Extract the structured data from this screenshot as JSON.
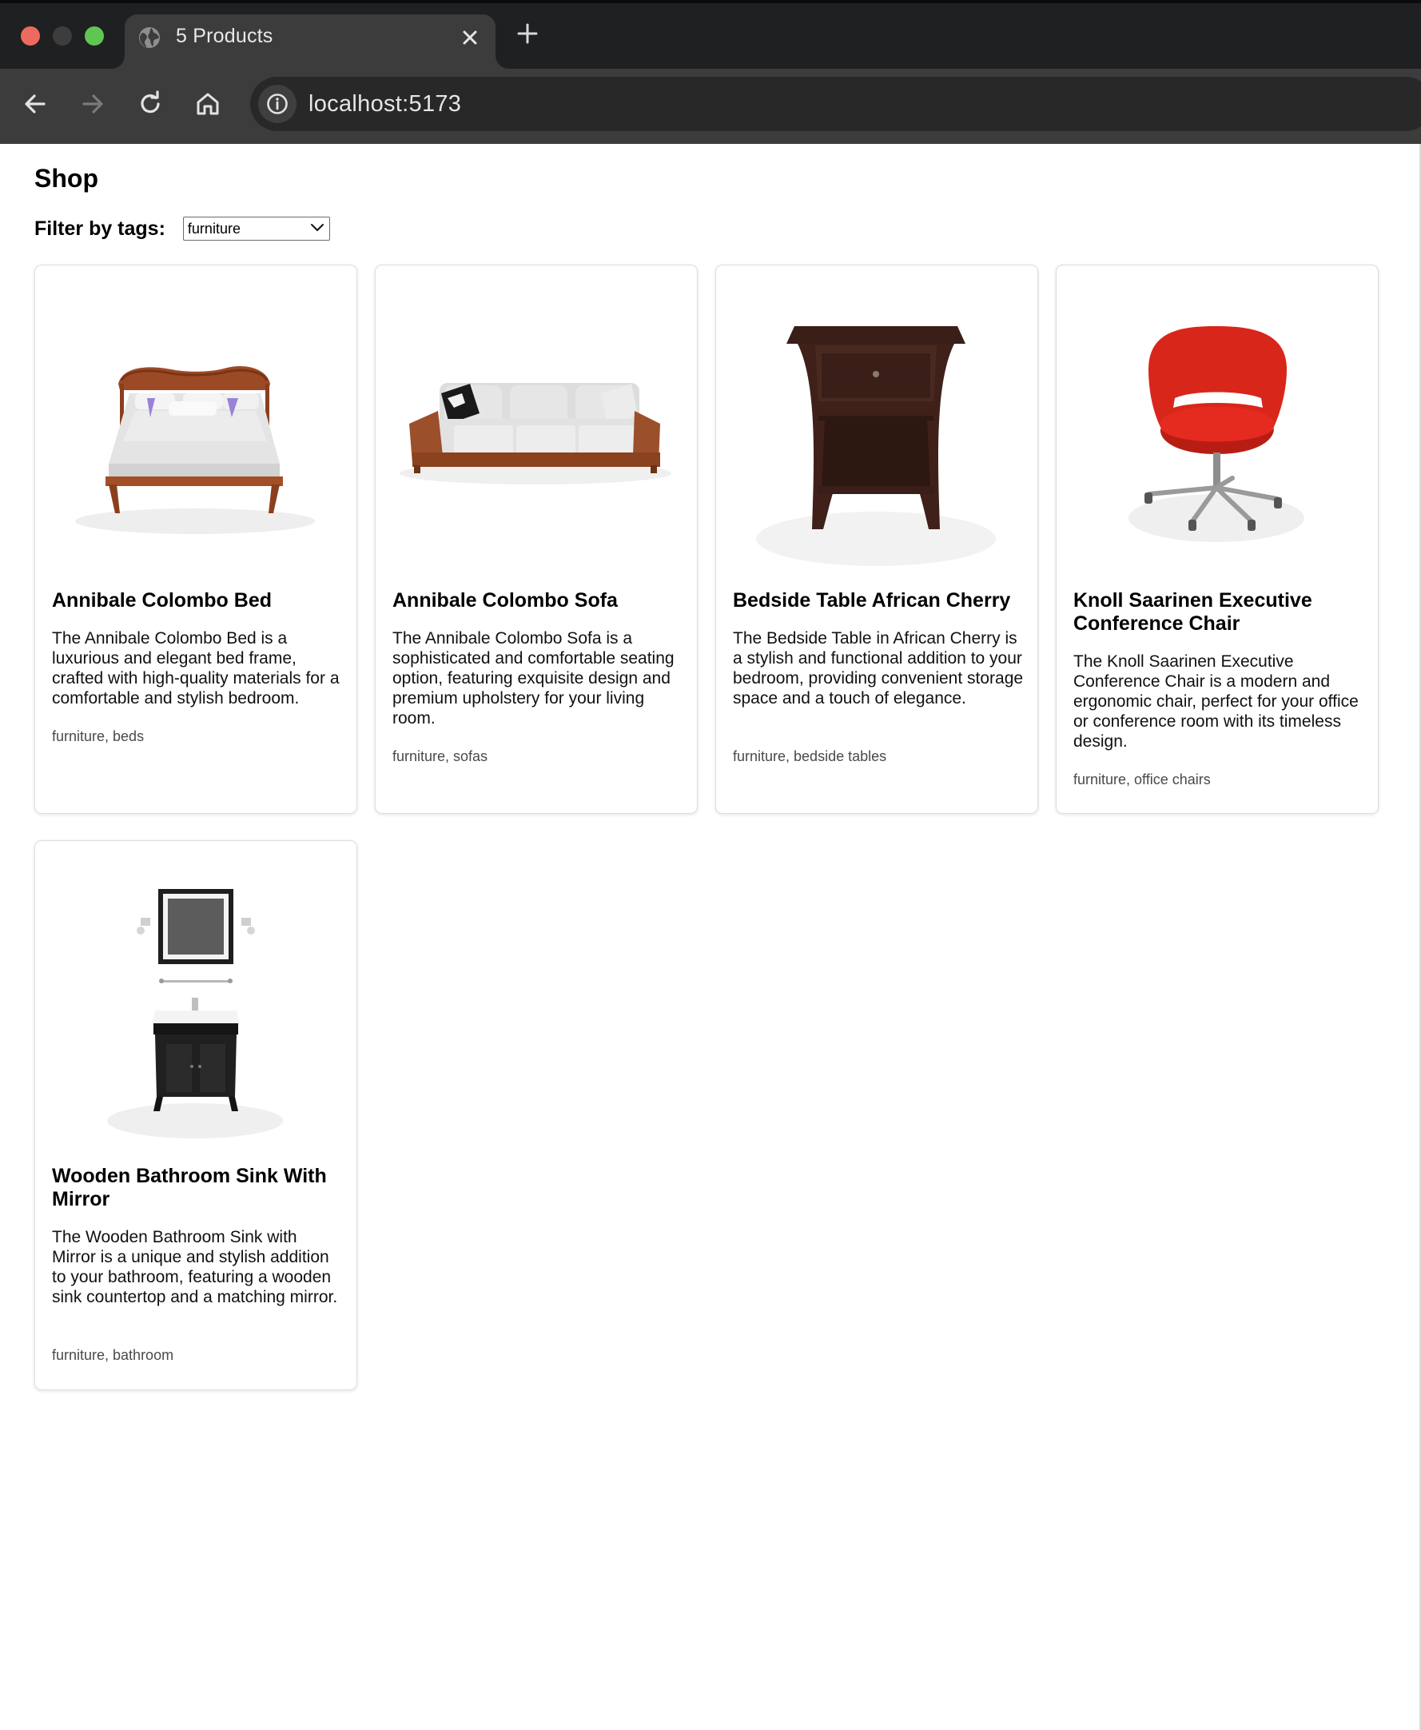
{
  "browser": {
    "tab_title": "5 Products",
    "url": "localhost:5173"
  },
  "icons": {
    "tab": "globe-icon",
    "close": "close-icon",
    "new_tab": "plus-icon",
    "back": "arrow-left-icon",
    "forward": "arrow-right-icon",
    "reload": "reload-icon",
    "home": "home-icon",
    "site_info": "info-icon",
    "select": "chevron-down-icon"
  },
  "shop": {
    "title": "Shop",
    "filter_label": "Filter by tags:",
    "filter_value": "furniture"
  },
  "products": [
    {
      "name": "Annibale Colombo Bed",
      "description": "The Annibale Colombo Bed is a luxurious and elegant bed frame, crafted with high-quality materials for a comfortable and stylish bedroom.",
      "tags": "furniture, beds"
    },
    {
      "name": "Annibale Colombo Sofa",
      "description": "The Annibale Colombo Sofa is a sophisticated and comfortable seating option, featuring exquisite design and premium upholstery for your living room.",
      "tags": "furniture, sofas"
    },
    {
      "name": "Bedside Table African Cherry",
      "description": "The Bedside Table in African Cherry is a stylish and functional addition to your bedroom, providing convenient storage space and a touch of elegance.",
      "tags": "furniture, bedside tables"
    },
    {
      "name": "Knoll Saarinen Executive Conference Chair",
      "description": "The Knoll Saarinen Executive Conference Chair is a modern and ergonomic chair, perfect for your office or conference room with its timeless design.",
      "tags": "furniture, office chairs"
    },
    {
      "name": "Wooden Bathroom Sink With Mirror",
      "description": "The Wooden Bathroom Sink with Mirror is a unique and stylish addition to your bathroom, featuring a wooden sink countertop and a matching mirror.",
      "tags": "furniture, bathroom"
    }
  ]
}
